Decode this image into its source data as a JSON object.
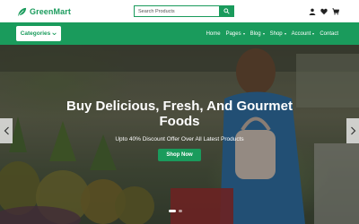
{
  "brand": {
    "name": "GreenMart",
    "accent": "#1a9b5c"
  },
  "search": {
    "placeholder": "Search Products"
  },
  "header_icons": [
    "user-icon",
    "heart-icon",
    "cart-icon"
  ],
  "nav": {
    "categories_label": "Categories",
    "menu": [
      {
        "label": "Home",
        "has_dropdown": false
      },
      {
        "label": "Pages",
        "has_dropdown": true
      },
      {
        "label": "Blog",
        "has_dropdown": true
      },
      {
        "label": "Shop",
        "has_dropdown": true
      },
      {
        "label": "Account",
        "has_dropdown": true
      },
      {
        "label": "Contact",
        "has_dropdown": false
      }
    ]
  },
  "hero": {
    "title_line1": "Buy Delicious, Fresh, And Gourmet",
    "title_line2": "Foods",
    "subtitle": "Upto 40% Discount Offer Over All Latest Products",
    "button_label": "Shop Now",
    "slides": 2,
    "active_slide": 1
  }
}
